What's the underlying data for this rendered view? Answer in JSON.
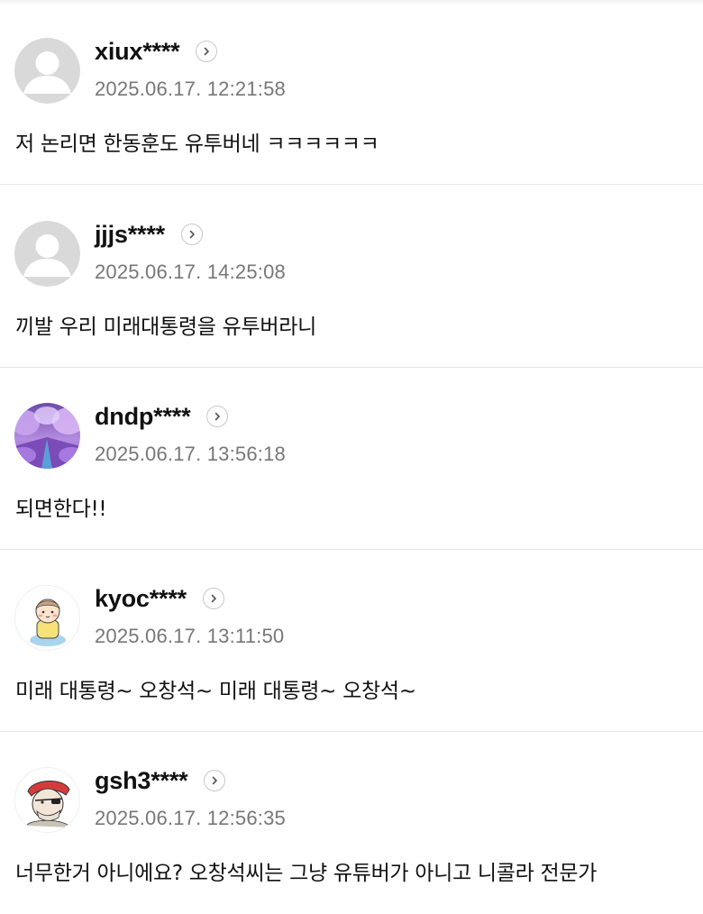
{
  "comments": [
    {
      "username": "xiux****",
      "timestamp": "2025.06.17. 12:21:58",
      "text": "저 논리면 한동훈도 유투버네 ㅋㅋㅋㅋㅋㅋ",
      "avatar": "default-avatar-icon"
    },
    {
      "username": "jjjs****",
      "timestamp": "2025.06.17. 14:25:08",
      "text": "끼발 우리 미래대통령을 유투버라니",
      "avatar": "default-avatar-icon"
    },
    {
      "username": "dndp****",
      "timestamp": "2025.06.17. 13:56:18",
      "text": "되면한다!!",
      "avatar": "purple-blossom-avatar"
    },
    {
      "username": "kyoc****",
      "timestamp": "2025.06.17. 13:11:50",
      "text": "미래 대통령~ 오창석~ 미래 대통령~ 오창석~",
      "avatar": "cartoon-child-avatar"
    },
    {
      "username": "gsh3****",
      "timestamp": "2025.06.17. 12:56:35",
      "text": "너무한거 아니에요? 오창석씨는 그냥 유튜버가 아니고 니콜라 전문가",
      "avatar": "cartoon-pirate-avatar"
    }
  ],
  "colors": {
    "username": "#111111",
    "timestamp": "#777777",
    "divider": "#e6e6e6",
    "default_avatar_bg": "#d9d9d9",
    "default_avatar_fg": "#ffffff"
  }
}
